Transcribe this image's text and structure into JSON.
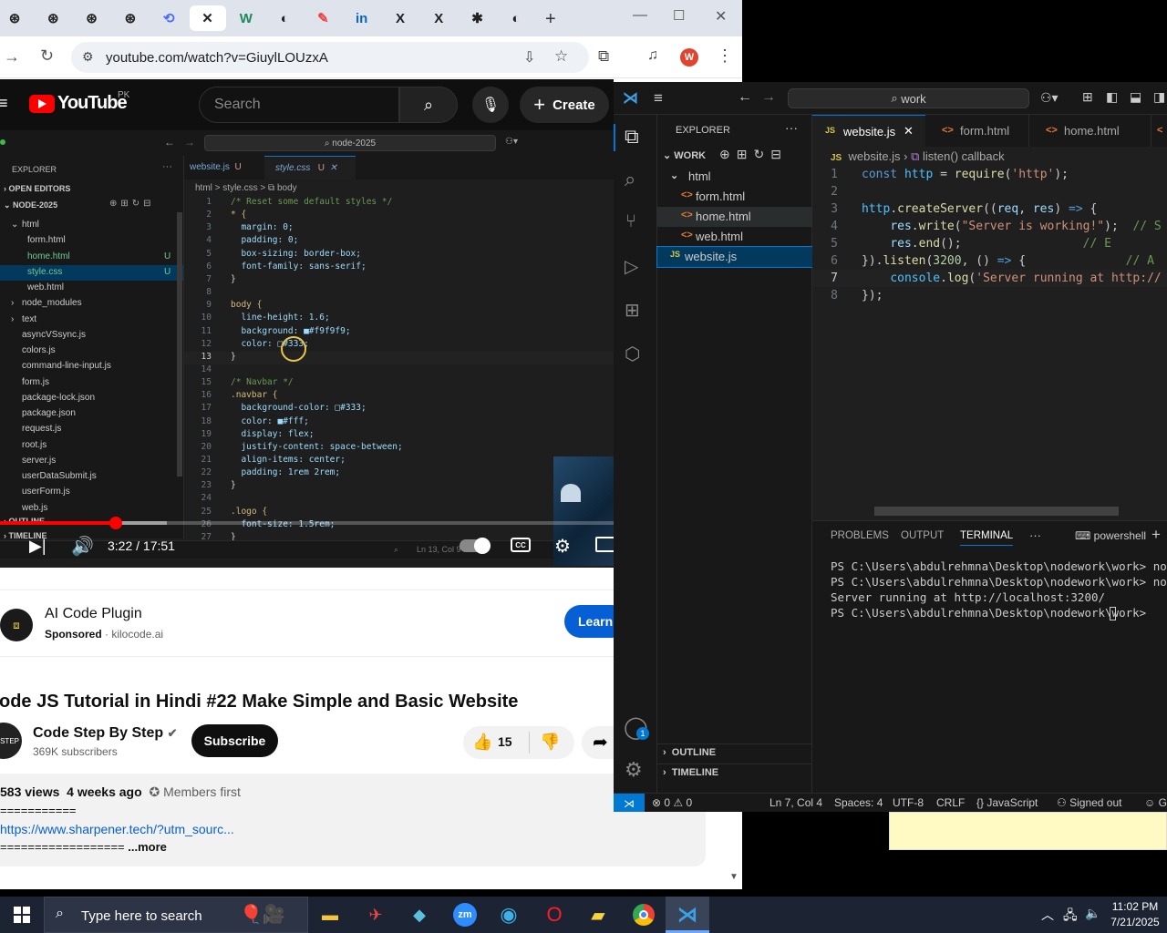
{
  "browser": {
    "tabs": [
      {
        "icon": "openai-icon",
        "glyph": "⊛"
      },
      {
        "icon": "openai-icon",
        "glyph": "⊛"
      },
      {
        "icon": "openai-icon",
        "glyph": "⊛"
      },
      {
        "icon": "openai-icon",
        "glyph": "⊛"
      },
      {
        "icon": "translate-icon",
        "glyph": "⟲"
      },
      {
        "icon": "close-icon",
        "glyph": "✕"
      },
      {
        "icon": "webflow-icon",
        "glyph": "W"
      },
      {
        "icon": "globe-icon",
        "glyph": "◐"
      },
      {
        "icon": "pen-icon",
        "glyph": "✎"
      },
      {
        "icon": "linkedin-icon",
        "glyph": "in"
      },
      {
        "icon": "x-icon",
        "glyph": "X"
      },
      {
        "icon": "x-icon",
        "glyph": "X"
      },
      {
        "icon": "slack-icon",
        "glyph": "✱"
      },
      {
        "icon": "globe-icon",
        "glyph": "◐"
      }
    ],
    "new_tab": "+",
    "url": "youtube.com/watch?v=GiuylLOUzxA",
    "profile_initial": "W"
  },
  "youtube": {
    "logo": "YouTube",
    "country": "PK",
    "search_placeholder": "Search",
    "create_label": "Create",
    "player": {
      "time": "3:22 / 17:51",
      "progress": 0.188,
      "buffered": 0.272
    },
    "ad": {
      "title": "AI Code Plugin",
      "sponsored": "Sponsored",
      "domain": "kilocode.ai",
      "cta": "Learn"
    },
    "video_title": "ode JS Tutorial in Hindi #22 Make Simple and Basic Website",
    "channel": {
      "name": "Code Step By Step",
      "subs": "369K subscribers",
      "subscribe": "Subscribe",
      "likes": "15"
    },
    "desc": {
      "views": "583 views",
      "ago": "4 weeks ago",
      "members": "Members first",
      "line1": "===========",
      "link": "https://www.sharpener.tech/?utm_sourc...",
      "line3": "==================",
      "more": "...more"
    }
  },
  "embedded": {
    "search": "node-2025",
    "explorer": "EXPLORER",
    "open_editors": "OPEN EDITORS",
    "project": "NODE-2025",
    "tabs": [
      {
        "name": "website.js",
        "badge": "U"
      },
      {
        "name": "style.css",
        "badge": "U"
      }
    ],
    "breadcrumb": "html > style.css > ⧉ body",
    "tree": [
      {
        "t": "html",
        "d": 1,
        "b": ""
      },
      {
        "t": "form.html",
        "d": 2,
        "b": ""
      },
      {
        "t": "home.html",
        "d": 2,
        "b": "U"
      },
      {
        "t": "style.css",
        "d": 2,
        "b": "U"
      },
      {
        "t": "web.html",
        "d": 2,
        "b": ""
      },
      {
        "t": "node_modules",
        "d": 1,
        "b": ""
      },
      {
        "t": "text",
        "d": 1,
        "b": ""
      },
      {
        "t": "asyncVSsync.js",
        "d": 1,
        "b": ""
      },
      {
        "t": "colors.js",
        "d": 1,
        "b": ""
      },
      {
        "t": "command-line-input.js",
        "d": 1,
        "b": ""
      },
      {
        "t": "form.js",
        "d": 1,
        "b": ""
      },
      {
        "t": "package-lock.json",
        "d": 1,
        "b": ""
      },
      {
        "t": "package.json",
        "d": 1,
        "b": ""
      },
      {
        "t": "request.js",
        "d": 1,
        "b": ""
      },
      {
        "t": "root.js",
        "d": 1,
        "b": ""
      },
      {
        "t": "server.js",
        "d": 1,
        "b": ""
      },
      {
        "t": "userDataSubmit.js",
        "d": 1,
        "b": ""
      },
      {
        "t": "userForm.js",
        "d": 1,
        "b": ""
      },
      {
        "t": "web.js",
        "d": 1,
        "b": ""
      }
    ],
    "outline": "OUTLINE",
    "timeline": "TIMELINE",
    "code": [
      "/* Reset some default styles */",
      "* {",
      "  margin: 0;",
      "  padding: 0;",
      "  box-sizing: border-box;",
      "  font-family: sans-serif;",
      "}",
      "",
      "body {",
      "  line-height: 1.6;",
      "  background: ■#f9f9f9;",
      "  color: □#333;",
      "}",
      "",
      "/* Navbar */",
      ".navbar {",
      "  background-color: □#333;",
      "  color: ■#fff;",
      "  display: flex;",
      "  justify-content: space-between;",
      "  align-items: center;",
      "  padding: 1rem 2rem;",
      "}",
      "",
      ".logo {",
      "  font-size: 1.5rem;",
      "}"
    ],
    "status": "Ln 13, Col 9"
  },
  "vscode": {
    "search": "work",
    "explorer": "EXPLORER",
    "root": "WORK",
    "tree": [
      {
        "t": "html",
        "d": 1,
        "kind": "folder"
      },
      {
        "t": "form.html",
        "d": 2,
        "kind": "html"
      },
      {
        "t": "home.html",
        "d": 2,
        "kind": "html"
      },
      {
        "t": "web.html",
        "d": 2,
        "kind": "html"
      },
      {
        "t": "website.js",
        "d": 1,
        "kind": "js"
      }
    ],
    "tabs": [
      {
        "name": "website.js",
        "kind": "js"
      },
      {
        "name": "form.html",
        "kind": "html"
      },
      {
        "name": "home.html",
        "kind": "html"
      }
    ],
    "breadcrumb": {
      "file": "website.js",
      "symbol": "listen() callback"
    },
    "code": [
      [
        {
          "c": "#569cd6",
          "t": "const "
        },
        {
          "c": "#4fc1ff",
          "t": "http"
        },
        {
          "c": "#ccc",
          "t": " = "
        },
        {
          "c": "#dcdcaa",
          "t": "require"
        },
        {
          "c": "#ccc",
          "t": "("
        },
        {
          "c": "#ce9178",
          "t": "'http'"
        },
        {
          "c": "#ccc",
          "t": ");"
        }
      ],
      [],
      [
        {
          "c": "#4fc1ff",
          "t": "http"
        },
        {
          "c": "#ccc",
          "t": "."
        },
        {
          "c": "#dcdcaa",
          "t": "createServer"
        },
        {
          "c": "#ccc",
          "t": "(("
        },
        {
          "c": "#9cdcfe",
          "t": "req"
        },
        {
          "c": "#ccc",
          "t": ", "
        },
        {
          "c": "#9cdcfe",
          "t": "res"
        },
        {
          "c": "#ccc",
          "t": ") "
        },
        {
          "c": "#569cd6",
          "t": "=>"
        },
        {
          "c": "#ccc",
          "t": " {"
        }
      ],
      [
        {
          "c": "#ccc",
          "t": "    "
        },
        {
          "c": "#9cdcfe",
          "t": "res"
        },
        {
          "c": "#ccc",
          "t": "."
        },
        {
          "c": "#dcdcaa",
          "t": "write"
        },
        {
          "c": "#ccc",
          "t": "("
        },
        {
          "c": "#ce9178",
          "t": "\"Server is working!\""
        },
        {
          "c": "#ccc",
          "t": ");  "
        },
        {
          "c": "#6a9955",
          "t": "// S"
        }
      ],
      [
        {
          "c": "#ccc",
          "t": "    "
        },
        {
          "c": "#9cdcfe",
          "t": "res"
        },
        {
          "c": "#ccc",
          "t": "."
        },
        {
          "c": "#dcdcaa",
          "t": "end"
        },
        {
          "c": "#ccc",
          "t": "();                 "
        },
        {
          "c": "#6a9955",
          "t": "// E"
        }
      ],
      [
        {
          "c": "#ccc",
          "t": "})."
        },
        {
          "c": "#dcdcaa",
          "t": "listen"
        },
        {
          "c": "#ccc",
          "t": "("
        },
        {
          "c": "#b5cea8",
          "t": "3200"
        },
        {
          "c": "#ccc",
          "t": ", () "
        },
        {
          "c": "#569cd6",
          "t": "=>"
        },
        {
          "c": "#ccc",
          "t": " {              "
        },
        {
          "c": "#6a9955",
          "t": "// A"
        }
      ],
      [
        {
          "c": "#ccc",
          "t": "    "
        },
        {
          "c": "#4fc1ff",
          "t": "console"
        },
        {
          "c": "#ccc",
          "t": "."
        },
        {
          "c": "#dcdcaa",
          "t": "log"
        },
        {
          "c": "#ccc",
          "t": "("
        },
        {
          "c": "#ce9178",
          "t": "'Server running at http://"
        }
      ],
      [
        {
          "c": "#ccc",
          "t": "});"
        }
      ]
    ],
    "panel_tabs": [
      "PROBLEMS",
      "OUTPUT",
      "TERMINAL"
    ],
    "shell": "powershell",
    "terminal": [
      "PS C:\\Users\\abdulrehmna\\Desktop\\nodework\\work> node w",
      "PS C:\\Users\\abdulrehmna\\Desktop\\nodework\\work> node w",
      "Server running at http://localhost:3200/",
      "PS C:\\Users\\abdulrehmna\\Desktop\\nodework\\work>"
    ],
    "outline": "OUTLINE",
    "timeline": "TIMELINE",
    "notification_count": "1",
    "status": {
      "errors": "0",
      "warnings": "0",
      "pos": "Ln 7, Col 4",
      "spaces": "Spaces: 4",
      "enc": "UTF-8",
      "eol": "CRLF",
      "lang": "JavaScript",
      "account": "Signed out",
      "tail": "G"
    }
  },
  "taskbar": {
    "search": "Type here to search",
    "time": "11:02 PM",
    "date": "7/21/2025"
  },
  "colors": {
    "yt_red": "#ff0000",
    "vs_blue": "#0078d4",
    "learn_blue": "#065fd4"
  }
}
